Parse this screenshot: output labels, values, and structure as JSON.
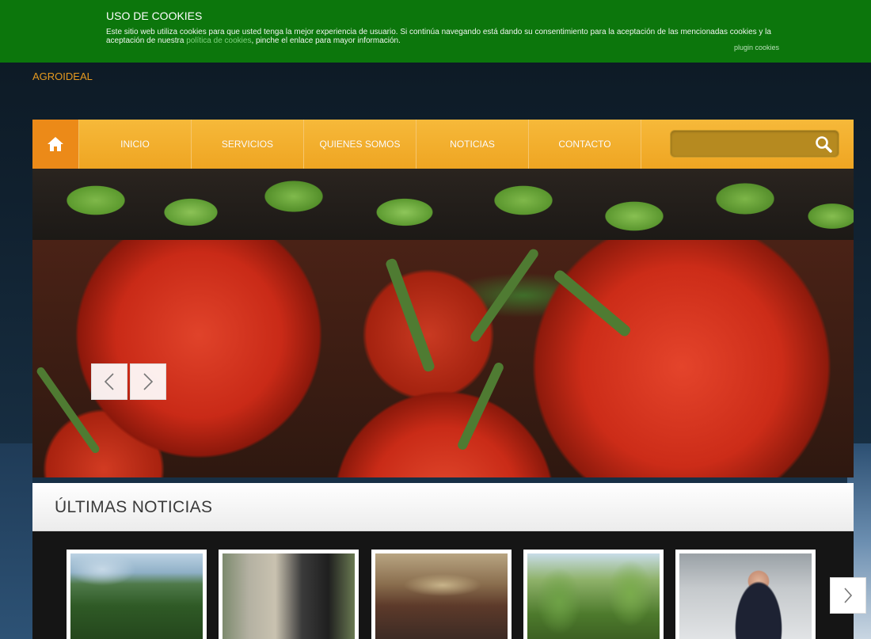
{
  "cookie_banner": {
    "title": "USO DE COOKIES",
    "text_before_link": "Este sitio web utiliza cookies para que usted tenga la mejor experiencia de usuario. Si continúa navegando está dando su consentimiento para la aceptación de las mencionadas cookies y la aceptación de nuestra ",
    "link_text": "política de cookies",
    "text_after_link": ", pinche el enlace para mayor información.",
    "plugin_label": "plugin cookies"
  },
  "brand": "AGROIDEAL",
  "nav": {
    "home_icon": "home-icon",
    "items": [
      {
        "label": "INICIO"
      },
      {
        "label": "SERVICIOS"
      },
      {
        "label": "QUIENES SOMOS"
      },
      {
        "label": "NOTICIAS"
      },
      {
        "label": "CONTACTO"
      }
    ],
    "search": {
      "placeholder": "",
      "value": "",
      "icon": "search-icon"
    }
  },
  "hero": {
    "prev_icon": "chevron-left-icon",
    "next_icon": "chevron-right-icon"
  },
  "news": {
    "title": "ÚLTIMAS NOTICIAS",
    "next_icon": "chevron-right-icon"
  },
  "colors": {
    "cookie_bg": "#0c760c",
    "brand": "#e69a1f",
    "nav_orange": "#f0a826",
    "home_orange": "#ec8a18"
  }
}
